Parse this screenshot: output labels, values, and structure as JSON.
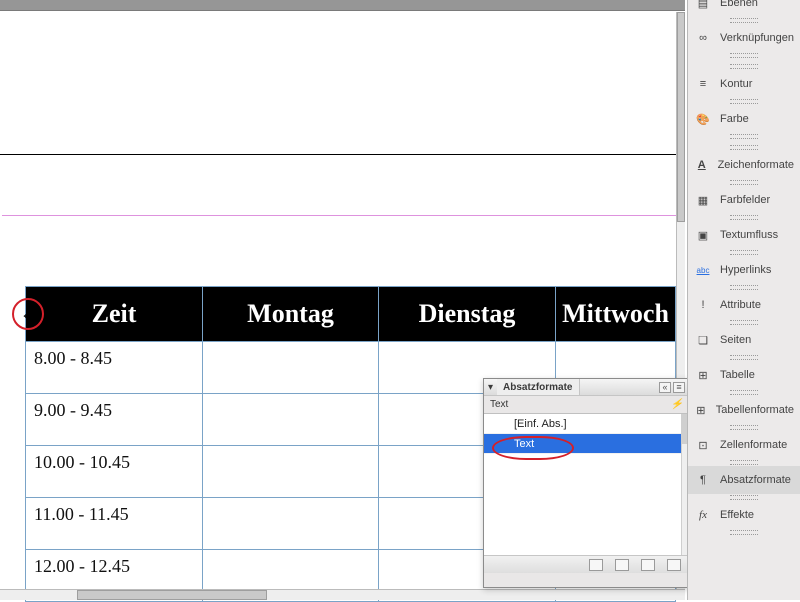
{
  "canvas": {
    "table": {
      "headers": [
        "Zeit",
        "Montag",
        "Dienstag",
        "Mittwoch"
      ],
      "rows": [
        {
          "time": "8.00 - 8.45"
        },
        {
          "time": "9.00 - 9.45"
        },
        {
          "time": "10.00 - 10.45"
        },
        {
          "time": "11.00 - 11.45"
        },
        {
          "time": "12.00 - 12.45"
        }
      ]
    }
  },
  "absatz_panel": {
    "title": "Absatzformate",
    "current": "Text",
    "items": [
      {
        "label": "[Einf. Abs.]",
        "selected": false
      },
      {
        "label": "Text",
        "selected": true
      }
    ],
    "flash_glyph": "⚡"
  },
  "dock": {
    "groups": [
      [
        {
          "key": "ebenen",
          "label": "Ebenen",
          "icon": "layers-icon"
        },
        {
          "key": "verk",
          "label": "Verknüpfungen",
          "icon": "links-icon"
        }
      ],
      [
        {
          "key": "kontur",
          "label": "Kontur",
          "icon": "stroke-icon"
        },
        {
          "key": "farbe",
          "label": "Farbe",
          "icon": "palette-icon"
        }
      ],
      [
        {
          "key": "zeichen",
          "label": "Zeichenformate",
          "icon": "charfmt-icon"
        },
        {
          "key": "farbfeld",
          "label": "Farbfelder",
          "icon": "swatches-icon"
        },
        {
          "key": "textumfl",
          "label": "Textumfluss",
          "icon": "wrap-icon"
        },
        {
          "key": "hyper",
          "label": "Hyperlinks",
          "icon": "hyperlink-icon"
        },
        {
          "key": "attr",
          "label": "Attribute",
          "icon": "attributes-icon"
        },
        {
          "key": "seiten",
          "label": "Seiten",
          "icon": "pages-icon"
        },
        {
          "key": "tabelle",
          "label": "Tabelle",
          "icon": "table-icon"
        },
        {
          "key": "tabform",
          "label": "Tabellenformate",
          "icon": "tablefmt-icon"
        },
        {
          "key": "zellform",
          "label": "Zellenformate",
          "icon": "cellfmt-icon"
        },
        {
          "key": "absform",
          "label": "Absatzformate",
          "icon": "parafmt-icon",
          "active": true
        },
        {
          "key": "effekte",
          "label": "Effekte",
          "icon": "fx-icon"
        }
      ]
    ]
  },
  "icons": {
    "layers-icon": "▤",
    "links-icon": "∞",
    "stroke-icon": "≡",
    "palette-icon": "🎨",
    "charfmt-icon": "A",
    "swatches-icon": "▦",
    "wrap-icon": "▣",
    "hyperlink-icon": "abc",
    "attributes-icon": "!",
    "pages-icon": "❏",
    "table-icon": "⊞",
    "tablefmt-icon": "⊞",
    "cellfmt-icon": "⊡",
    "parafmt-icon": "¶",
    "fx-icon": "fx"
  }
}
